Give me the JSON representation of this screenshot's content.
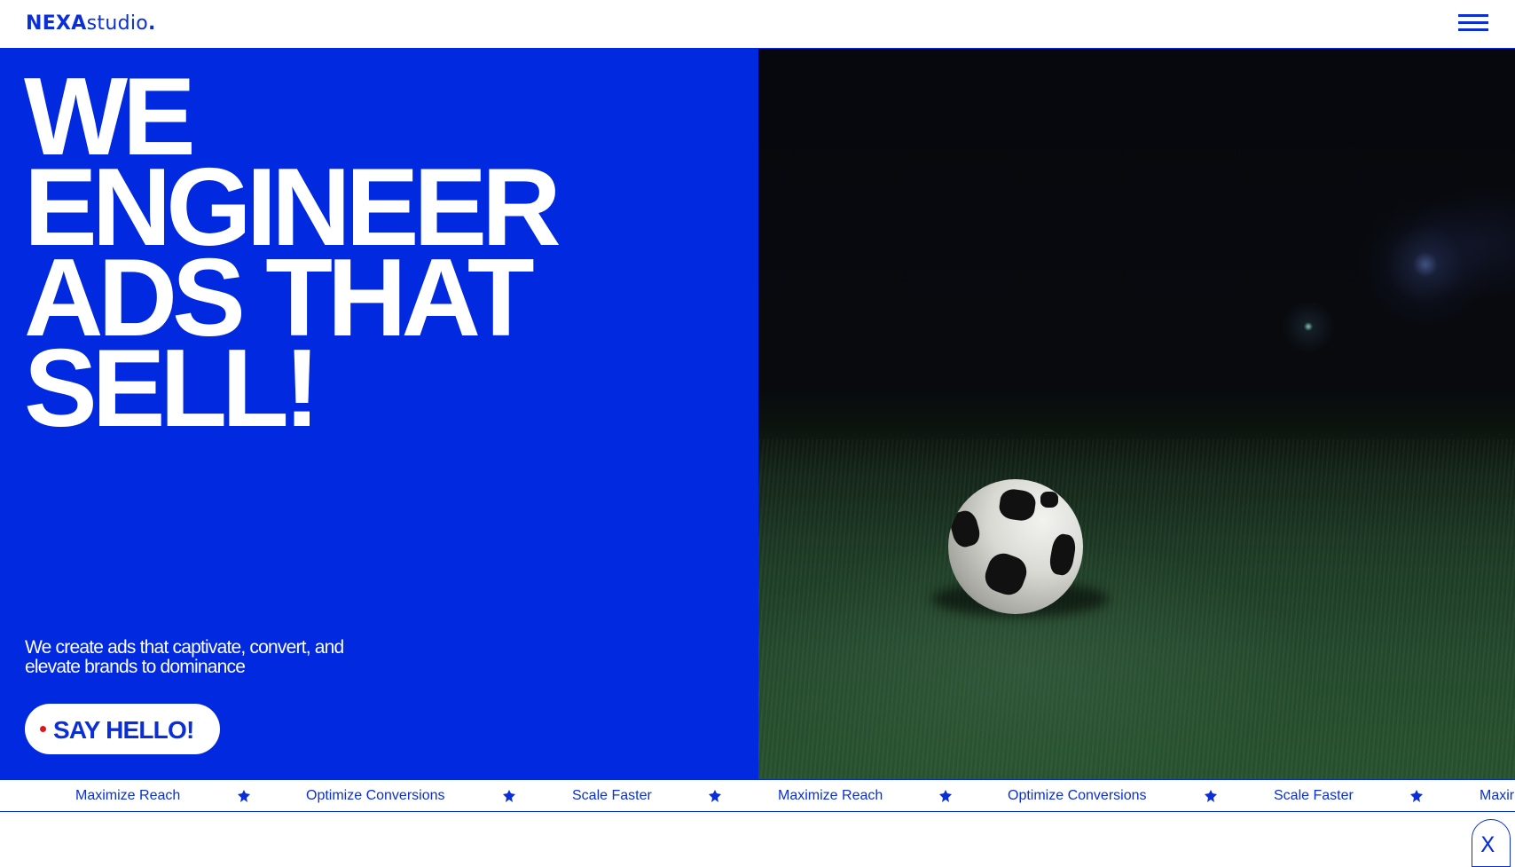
{
  "header": {
    "logo_bold": "NEXA",
    "logo_light": "studio",
    "logo_dot": ".",
    "menu_icon": "hamburger-menu-icon"
  },
  "hero": {
    "headline_lines": [
      "WE",
      "ENGINEER",
      "ADS THAT",
      "SELL!"
    ],
    "subtext_line1": "We create ads that captivate, convert, and",
    "subtext_line2": "elevate brands to dominance",
    "cta_label": "SAY HELLO!",
    "image_icon": "soccer-ball-on-turf-image"
  },
  "ticker": {
    "items": [
      "Maximize Reach",
      "Optimize Conversions",
      "Scale Faster",
      "Maximize Reach",
      "Optimize Conversions",
      "Scale Faster",
      "Maxir"
    ],
    "separator_icon": "star-icon"
  },
  "social": {
    "x_label": "X",
    "icon": "x-logo-icon"
  },
  "colors": {
    "brand_blue": "#0029e0",
    "text_blue": "#0a2fd8",
    "cta_dot_red": "#e01515",
    "white": "#ffffff"
  }
}
